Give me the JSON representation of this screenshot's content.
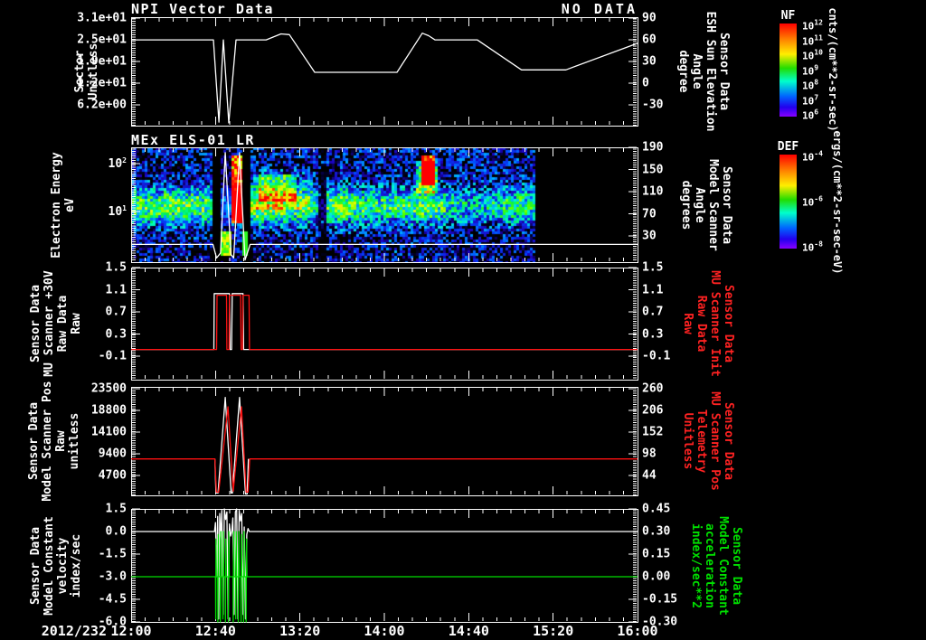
{
  "header": {
    "title": "NPI Vector Data",
    "no_data": "NO DATA",
    "title2": "MEx ELS-01 LR"
  },
  "time_axis": {
    "date": "2012/232",
    "ticks": [
      "12:00",
      "12:40",
      "13:20",
      "14:00",
      "14:40",
      "15:20",
      "16:00"
    ]
  },
  "colorbars": [
    {
      "id": "nf",
      "title": "NF",
      "unit": "cnts/(cm**2-sr-sec)",
      "tick_base": "10",
      "tick_exponents": [
        "12",
        "11",
        "10",
        "9",
        "8",
        "7",
        "6"
      ]
    },
    {
      "id": "def",
      "title": "DEF",
      "unit": "ergs/(cm**2-sr-sec-eV)",
      "tick_base": "10",
      "tick_exponents": [
        "-4",
        "-6",
        "-8"
      ]
    }
  ],
  "panels": [
    {
      "id": "p1",
      "left_label": [
        "Sector",
        "Unitless"
      ],
      "left_ticks": [
        "3.1e+01",
        "2.5e+01",
        "1.9e+01",
        "1.2e+01",
        "6.2e+00"
      ],
      "right_label": [
        "Sensor Data",
        "ESH Sun Elevation",
        "Angle",
        "degree"
      ],
      "right_ticks": [
        "90",
        "60",
        "30",
        "0",
        "-30"
      ],
      "right_label_color": "#ffffff"
    },
    {
      "id": "p2",
      "left_label": [
        "Electron Energy",
        "eV"
      ],
      "left_ticks_exp": [
        "2",
        "1"
      ],
      "left_tick_base": "10",
      "right_label": [
        "Sensor Data",
        "Model Scanner",
        "Angle",
        "degrees"
      ],
      "right_ticks": [
        "190",
        "150",
        "110",
        "70",
        "30"
      ],
      "right_label_color": "#ffffff"
    },
    {
      "id": "p3",
      "left_label": [
        "Sensor Data",
        "MU Scanner +30V",
        "Raw Data",
        "Raw"
      ],
      "left_ticks": [
        "1.5",
        "1.1",
        "0.7",
        "0.3",
        "-0.1"
      ],
      "right_label": [
        "Sensor Data",
        "MU Scanner Init",
        "Raw Data",
        "Raw"
      ],
      "right_ticks": [
        "1.5",
        "1.1",
        "0.7",
        "0.3",
        "-0.1"
      ],
      "right_label_color": "#ff2222"
    },
    {
      "id": "p4",
      "left_label": [
        "Sensor Data",
        "Model Scanner Pos",
        "Raw",
        "unitless"
      ],
      "left_ticks": [
        "23500",
        "18800",
        "14100",
        "9400",
        "4700"
      ],
      "right_label": [
        "Sensor Data",
        "MU Scanner Pos",
        "Telemetry",
        "Unitless"
      ],
      "right_ticks": [
        "260",
        "206",
        "152",
        "98",
        "44"
      ],
      "right_label_color": "#ff2222"
    },
    {
      "id": "p5",
      "left_label": [
        "Sensor Data",
        "Model Constant",
        "velocity",
        "index/sec"
      ],
      "left_ticks": [
        "1.5",
        "0.0",
        "-1.5",
        "-3.0",
        "-4.5",
        "-6.0"
      ],
      "right_label": [
        "Sensor Data",
        "Model Constant",
        "acceleration",
        "index/sec**2"
      ],
      "right_ticks": [
        "0.45",
        "0.30",
        "0.15",
        "0.00",
        "-0.15",
        "-0.30"
      ],
      "right_label_color": "#00e000"
    }
  ],
  "chart_data": [
    {
      "id": "p1",
      "type": "line",
      "title": "NPI Vector Data",
      "annotation": "NO DATA",
      "ylabel": "Sector Unitless",
      "ylim": [
        0.2,
        31.3
      ],
      "yticks": [
        31,
        24.8,
        18.6,
        12.4,
        6.2
      ],
      "right_ylabel": "Sensor Data ESH Sun Elevation Angle degree",
      "right_yticks": [
        90,
        60,
        30,
        0,
        -30
      ],
      "x_minutes_from": "12:00",
      "xlim_minutes": [
        0,
        240
      ],
      "series": [
        {
          "name": "sector",
          "color": "#ffffff",
          "points": [
            [
              0,
              24.8
            ],
            [
              39,
              24.8
            ],
            [
              41.6,
              1.2
            ],
            [
              43.7,
              24.8
            ],
            [
              46.3,
              1.0
            ],
            [
              49.7,
              24.8
            ],
            [
              64,
              24.8
            ],
            [
              71,
              26.5
            ],
            [
              75,
              26.3
            ],
            [
              87,
              15.5
            ],
            [
              126,
              15.5
            ],
            [
              138,
              26.7
            ],
            [
              141,
              26.0
            ],
            [
              144,
              24.8
            ],
            [
              164,
              24.8
            ],
            [
              185,
              16.2
            ],
            [
              206,
              16.2
            ],
            [
              240,
              23.8
            ]
          ]
        }
      ]
    },
    {
      "id": "p2",
      "type": "spectrogram",
      "title": "MEx ELS-01 LR",
      "ylabel": "Electron Energy eV",
      "ylog": true,
      "ylim": [
        0.9,
        219
      ],
      "yticks": [
        100,
        10
      ],
      "right_yticks": [
        190,
        150,
        110,
        70,
        30
      ],
      "zunits": "ergs/(cm**2-sr-sec-eV)",
      "data_end_min": 191.5,
      "band_center_ev": 22,
      "band_profile": [
        [
          0,
          0.45
        ],
        [
          20,
          0.47
        ],
        [
          36,
          0.45
        ],
        [
          38.5,
          0.43
        ],
        [
          43,
          0.41
        ],
        [
          48,
          0.41
        ],
        [
          56.6,
          0.51
        ],
        [
          60,
          0.54
        ],
        [
          68,
          0.54
        ],
        [
          78,
          0.49
        ],
        [
          85,
          0.45
        ],
        [
          88.5,
          0.25
        ],
        [
          92.5,
          0.41
        ],
        [
          94,
          0.51
        ],
        [
          100,
          0.52
        ],
        [
          104,
          0.46
        ],
        [
          112,
          0.41
        ],
        [
          120,
          0.39
        ],
        [
          128,
          0.43
        ],
        [
          134,
          0.45
        ],
        [
          140,
          0.48
        ],
        [
          146,
          0.43
        ],
        [
          151,
          0.36
        ],
        [
          158,
          0.31
        ],
        [
          166,
          0.3
        ],
        [
          172,
          0.33
        ],
        [
          178,
          0.37
        ],
        [
          184,
          0.41
        ],
        [
          191.5,
          0.38
        ]
      ],
      "gaps": [
        [
          38.8,
          42.4,
          0
        ],
        [
          42.4,
          48,
          0.6
        ],
        [
          52.7,
          56.6,
          0
        ],
        [
          88.2,
          92.3,
          0.3
        ],
        [
          121.7,
          122.7,
          0
        ],
        [
          124.4,
          125.3,
          0
        ],
        [
          191.5,
          240,
          0
        ]
      ],
      "hotspots": [
        {
          "t0": 48,
          "t1": 52.6,
          "y0": 172,
          "y1": 248,
          "add": 0.75,
          "exempt": false
        },
        {
          "t0": 42.6,
          "t1": 47.6,
          "y0": 256,
          "y1": 284,
          "add": 0.6,
          "exempt": true
        },
        {
          "t0": 52.9,
          "t1": 55.8,
          "y0": 256,
          "y1": 284,
          "add": 0.6,
          "exempt": true
        },
        {
          "t0": 60,
          "t1": 78,
          "y0": 194,
          "y1": 224,
          "add": 0.25,
          "exempt": false
        },
        {
          "t0": 57,
          "t1": 86,
          "y0": 188,
          "y1": 232,
          "add": 0.08,
          "exempt": false
        },
        {
          "t0": 137.5,
          "t1": 143.5,
          "y0": 172,
          "y1": 205,
          "add": 0.8,
          "exempt": false
        },
        {
          "t0": 135.5,
          "t1": 145.5,
          "y0": 178,
          "y1": 215,
          "add": 0.3,
          "exempt": false
        }
      ],
      "overlay_series": {
        "name": "scanner-trace",
        "color": "#ffffff",
        "points": [
          [
            0,
            2.1
          ],
          [
            38.8,
            2.1
          ],
          [
            40.5,
            1.1
          ],
          [
            42.4,
            1.4
          ],
          [
            44.6,
            170
          ],
          [
            47.3,
            1.3
          ],
          [
            48.6,
            1.1
          ],
          [
            51.4,
            170
          ],
          [
            54,
            1.0
          ],
          [
            56.4,
            2.1
          ],
          [
            240,
            2.1
          ]
        ]
      }
    },
    {
      "id": "p3",
      "type": "line",
      "ylim": [
        -0.525,
        1.5
      ],
      "yticks": [
        1.5,
        1.1,
        0.7,
        0.3,
        -0.1
      ],
      "series": [
        {
          "name": "mu-scanner-30v",
          "color": "#ffffff",
          "points": [
            [
              0,
              0.02
            ],
            [
              39.2,
              0.02
            ],
            [
              39.4,
              1.03
            ],
            [
              46.6,
              1.03
            ],
            [
              46.9,
              0.02
            ],
            [
              47.6,
              0.02
            ],
            [
              47.9,
              1.03
            ],
            [
              53.0,
              1.03
            ],
            [
              53.3,
              0.02
            ],
            [
              240,
              0.02
            ]
          ]
        },
        {
          "name": "mu-scanner-init",
          "color": "#ff1111",
          "points": [
            [
              0,
              0.02
            ],
            [
              40.5,
              0.02
            ],
            [
              40.7,
              1.0
            ],
            [
              45.2,
              1.0
            ],
            [
              45.4,
              0.02
            ],
            [
              46.4,
              0.02
            ],
            [
              46.6,
              1.0
            ],
            [
              51.9,
              1.0
            ],
            [
              52.1,
              0.02
            ],
            [
              52.8,
              0.02
            ],
            [
              53.0,
              1.0
            ],
            [
              55.9,
              1.0
            ],
            [
              56.1,
              0.02
            ],
            [
              240,
              0.02
            ]
          ]
        }
      ]
    },
    {
      "id": "p4",
      "type": "line",
      "ylim": [
        400,
        23900
      ],
      "yticks": [
        23500,
        18800,
        14100,
        9400,
        4700
      ],
      "right_yticks": [
        260,
        206,
        152,
        98,
        44
      ],
      "series": [
        {
          "name": "model-scanner-pos",
          "color": "#ffffff",
          "points": [
            [
              39.7,
              8300
            ],
            [
              40.2,
              900
            ],
            [
              41.2,
              900
            ],
            [
              44.6,
              21600
            ],
            [
              47.4,
              900
            ],
            [
              48.0,
              900
            ],
            [
              51.4,
              21600
            ],
            [
              54.2,
              700
            ],
            [
              55.0,
              700
            ],
            [
              55.6,
              8300
            ]
          ]
        },
        {
          "name": "mu-scanner-pos-telemetry",
          "color": "#ff1111",
          "points": [
            [
              0,
              8300
            ],
            [
              39.7,
              8300
            ],
            [
              40.4,
              1100
            ],
            [
              41.5,
              1100
            ],
            [
              45.9,
              19600
            ],
            [
              48.4,
              1300
            ],
            [
              52.3,
              19600
            ],
            [
              54.5,
              1100
            ],
            [
              55.4,
              1100
            ],
            [
              56.2,
              8300
            ],
            [
              240,
              8300
            ]
          ]
        }
      ]
    },
    {
      "id": "p5",
      "type": "line",
      "ylim": [
        -6,
        1.5
      ],
      "right_ylim": [
        -0.3,
        0.45
      ],
      "yticks": [
        1.5,
        0.0,
        -1.5,
        -3.0,
        -4.5,
        -6.0
      ],
      "right_yticks": [
        0.45,
        0.3,
        0.15,
        0.0,
        -0.15,
        -0.3
      ],
      "series": [
        {
          "name": "model-constant-velocity",
          "color": "#ffffff",
          "axis": "left",
          "points": [
            [
              0,
              0
            ],
            [
              39.5,
              0
            ],
            [
              40,
              0.6
            ],
            [
              40.6,
              -3
            ],
            [
              41,
              1.0
            ],
            [
              41.5,
              -5.8
            ],
            [
              42,
              1.2
            ],
            [
              42.5,
              -0.5
            ],
            [
              43,
              1.4
            ],
            [
              43.6,
              -5.5
            ],
            [
              44.2,
              1.5
            ],
            [
              44.8,
              0.8
            ],
            [
              45.4,
              1.3
            ],
            [
              46,
              -5.8
            ],
            [
              46.6,
              0.5
            ],
            [
              47.2,
              -0.3
            ],
            [
              47.7,
              0
            ],
            [
              48.2,
              0.9
            ],
            [
              48.8,
              -5.5
            ],
            [
              49.4,
              1.3
            ],
            [
              50,
              1.5
            ],
            [
              50.6,
              -5.8
            ],
            [
              51.2,
              1.4
            ],
            [
              51.8,
              0.7
            ],
            [
              52.4,
              1.2
            ],
            [
              53,
              -5.5
            ],
            [
              53.6,
              0.3
            ],
            [
              54.2,
              -5.8
            ],
            [
              54.8,
              -0.2
            ],
            [
              55.4,
              0.2
            ],
            [
              56,
              0
            ],
            [
              240,
              0
            ]
          ]
        },
        {
          "name": "model-constant-acceleration",
          "color": "#00dd00",
          "axis": "right",
          "points": [
            [
              0,
              0
            ],
            [
              40,
              0
            ],
            [
              40.1,
              -0.28
            ],
            [
              40.2,
              0.25
            ],
            [
              40.4,
              0
            ],
            [
              41,
              0
            ],
            [
              41.1,
              -0.3
            ],
            [
              41.3,
              0.28
            ],
            [
              41.5,
              0
            ],
            [
              42.2,
              0
            ],
            [
              42.3,
              -0.3
            ],
            [
              42.5,
              0.3
            ],
            [
              42.7,
              0
            ],
            [
              43.4,
              0
            ],
            [
              43.5,
              -0.28
            ],
            [
              43.7,
              0.3
            ],
            [
              43.9,
              0
            ],
            [
              44.6,
              0
            ],
            [
              44.7,
              -0.3
            ],
            [
              44.9,
              0.25
            ],
            [
              45.1,
              0
            ],
            [
              46,
              0
            ],
            [
              46.1,
              -0.3
            ],
            [
              46.3,
              0.3
            ],
            [
              46.5,
              0
            ],
            [
              48.3,
              0
            ],
            [
              48.4,
              -0.3
            ],
            [
              48.6,
              0.3
            ],
            [
              48.8,
              0
            ],
            [
              49.5,
              0
            ],
            [
              49.6,
              -0.28
            ],
            [
              49.8,
              0.3
            ],
            [
              50,
              0
            ],
            [
              50.7,
              0
            ],
            [
              50.8,
              -0.3
            ],
            [
              51,
              0.3
            ],
            [
              51.2,
              0
            ],
            [
              52,
              0
            ],
            [
              52.1,
              -0.3
            ],
            [
              52.3,
              0.28
            ],
            [
              52.5,
              0
            ],
            [
              53.2,
              0
            ],
            [
              53.3,
              -0.3
            ],
            [
              53.5,
              0.3
            ],
            [
              53.7,
              0
            ],
            [
              54.4,
              0
            ],
            [
              54.5,
              -0.3
            ],
            [
              54.7,
              0.25
            ],
            [
              54.9,
              0
            ],
            [
              55.6,
              0
            ],
            [
              56,
              0
            ],
            [
              240,
              0
            ]
          ]
        }
      ]
    }
  ]
}
